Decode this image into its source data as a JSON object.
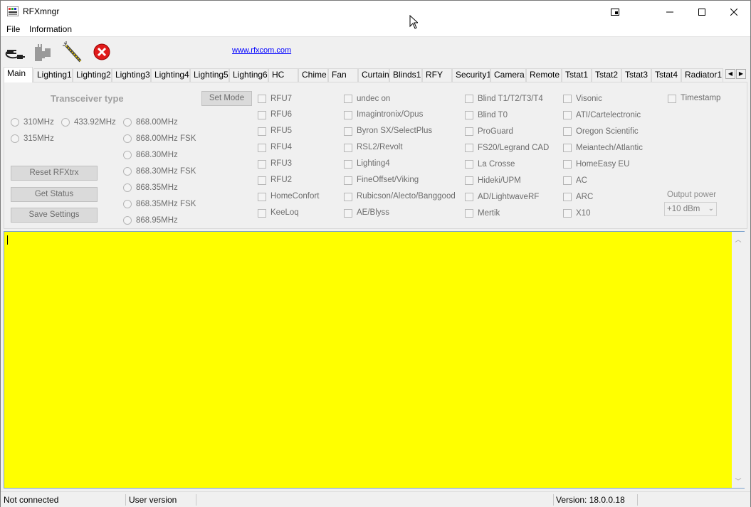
{
  "window": {
    "title": "RFXmngr"
  },
  "menu": [
    "File",
    "Information"
  ],
  "toolbar": {
    "link": "www.rfxcom.com"
  },
  "tabs": [
    "Main",
    "Lighting1",
    "Lighting2",
    "Lighting3",
    "Lighting4",
    "Lighting5",
    "Lighting6",
    "HC",
    "Chime",
    "Fan",
    "Curtain",
    "Blinds1",
    "RFY",
    "Security1",
    "Camera",
    "Remote",
    "Tstat1",
    "Tstat2",
    "Tstat3",
    "Tstat4",
    "Radiator1"
  ],
  "main": {
    "heading": "Transceiver type",
    "set_mode": "Set Mode",
    "freq_left": [
      "310MHz",
      "433.92MHz",
      "315MHz"
    ],
    "freq_right": [
      "868.00MHz",
      "868.00MHz FSK",
      "868.30MHz",
      "868.30MHz FSK",
      "868.35MHz",
      "868.35MHz FSK",
      "868.95MHz"
    ],
    "buttons": [
      "Reset RFXtrx",
      "Get Status",
      "Save Settings"
    ],
    "col1": [
      "RFU7",
      "RFU6",
      "RFU5",
      "RFU4",
      "RFU3",
      "RFU2",
      "HomeConfort",
      "KeeLoq"
    ],
    "col2": [
      "undec on",
      "Imagintronix/Opus",
      "Byron SX/SelectPlus",
      "RSL2/Revolt",
      "Lighting4",
      "FineOffset/Viking",
      "Rubicson/Alecto/Banggood",
      "AE/Blyss"
    ],
    "col3": [
      "Blind T1/T2/T3/T4",
      "Blind T0",
      "ProGuard",
      "FS20/Legrand CAD",
      "La Crosse",
      "Hideki/UPM",
      "AD/LightwaveRF",
      "Mertik"
    ],
    "col4": [
      "Visonic",
      "ATI/Cartelectronic",
      "Oregon Scientific",
      "Meiantech/Atlantic",
      "HomeEasy EU",
      "AC",
      "ARC",
      "X10"
    ],
    "timestamp": "Timestamp",
    "output_power_label": "Output power",
    "output_power_value": "+10 dBm"
  },
  "status": {
    "connection": "Not connected",
    "user": "User version",
    "version": "Version: 18.0.0.18"
  },
  "colors": {
    "log_background": "#ffff00",
    "link": "#0000ff"
  }
}
